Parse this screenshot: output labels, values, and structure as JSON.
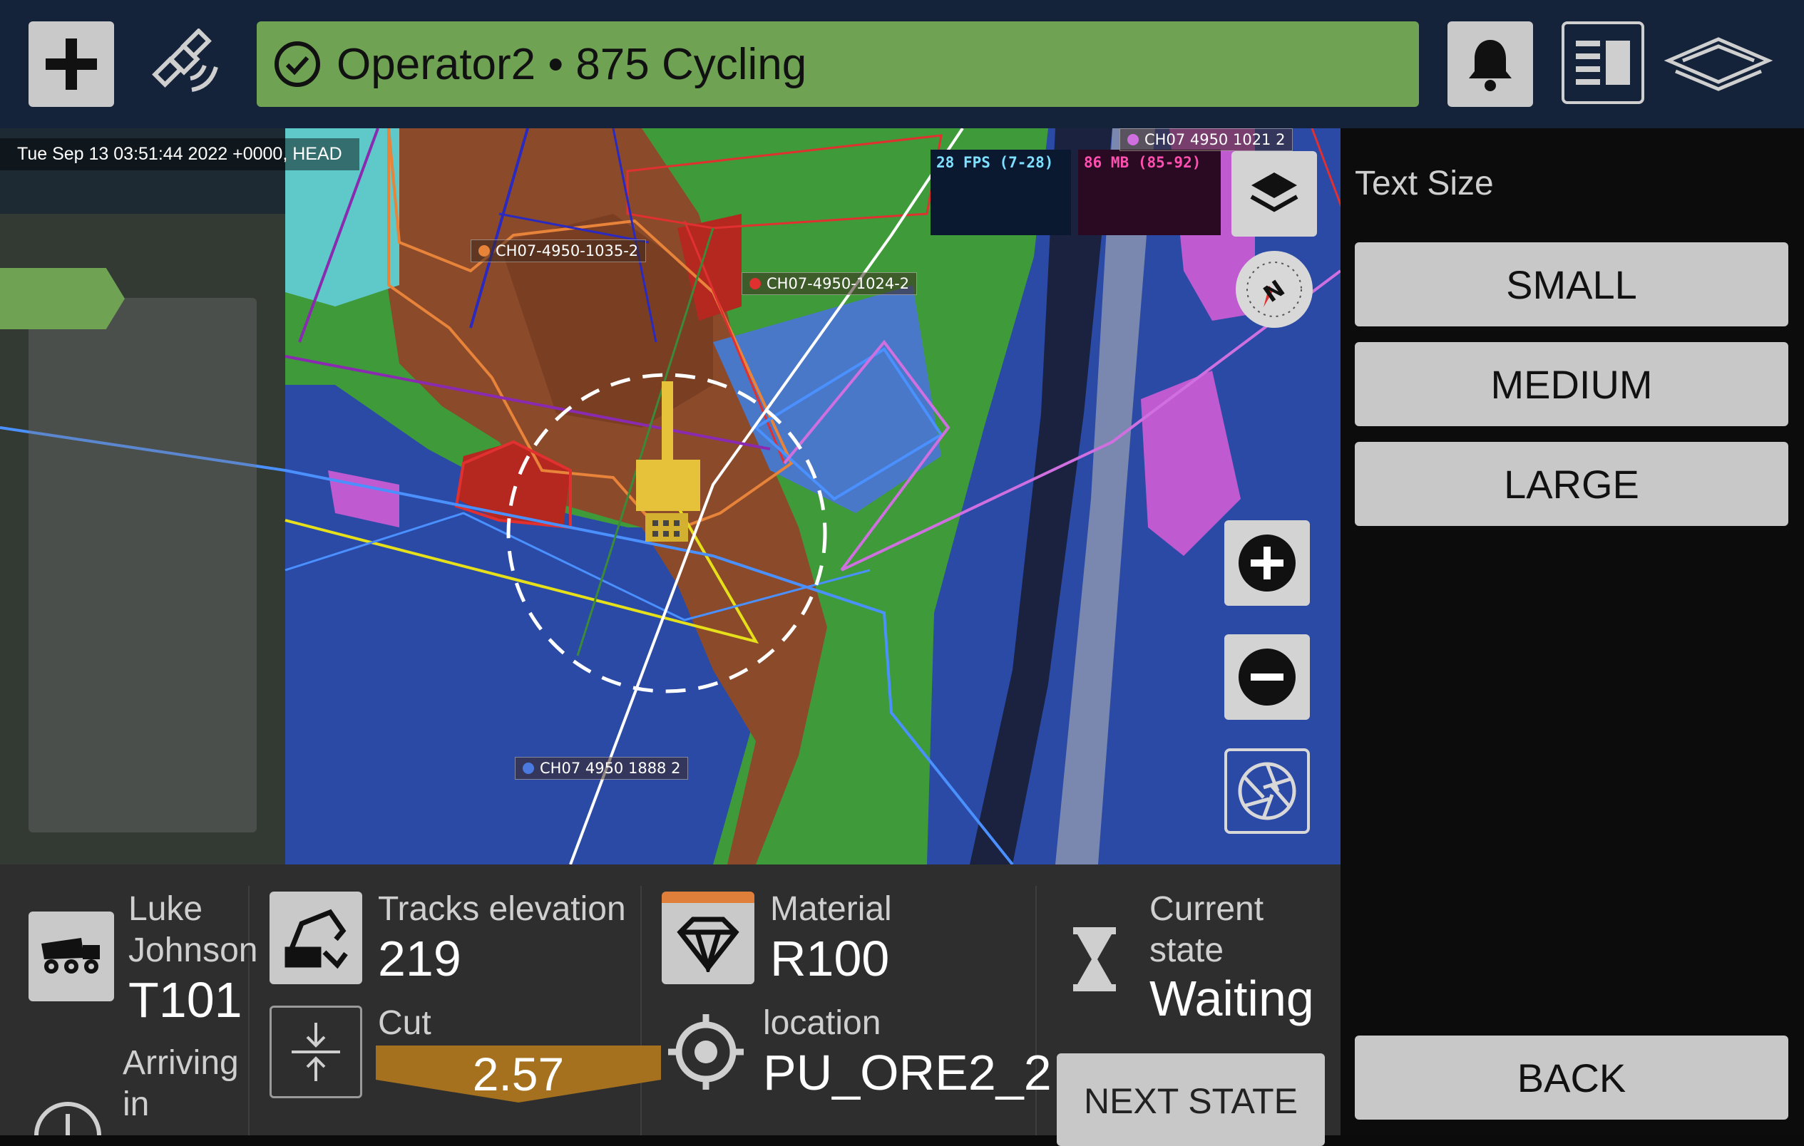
{
  "header": {
    "status_text": "Operator2 • 875 Cycling",
    "status_color": "#6fa253",
    "icons": [
      "plus-icon",
      "satellite-icon",
      "check-circle-icon",
      "bell-icon",
      "panel-toggle-icon",
      "brand-logo-icon"
    ]
  },
  "map": {
    "timestamp": "Tue Sep 13 03:51:44 2022 +0000, HEAD",
    "fps": "28 FPS (7-28)",
    "memory": "86 MB (85-92)",
    "labels": [
      {
        "text": "CH07-4950-1035-2",
        "color": "#e8833a"
      },
      {
        "text": "CH07-4950-1024-2",
        "color": "#e03030"
      },
      {
        "text": "CH07 4950 1021 2",
        "color": "#d070e0"
      },
      {
        "text": "CH07 4950 1888 2",
        "color": "#4a7ae0"
      }
    ]
  },
  "text_size_panel": {
    "title": "Text Size",
    "options": [
      "SMALL",
      "MEDIUM",
      "LARGE"
    ],
    "back_label": "BACK"
  },
  "info": {
    "truck": {
      "driver": "Luke Johnson",
      "id": "T101",
      "arriving_label": "Arriving in"
    },
    "tracks": {
      "label": "Tracks elevation",
      "value": "219"
    },
    "cut": {
      "label": "Cut",
      "value": "2.57"
    },
    "material": {
      "label": "Material",
      "value": "R100"
    },
    "location": {
      "label": "location",
      "value": "PU_ORE2_2"
    },
    "state": {
      "label": "Current state",
      "value": "Waiting",
      "next_label": "NEXT STATE"
    }
  }
}
